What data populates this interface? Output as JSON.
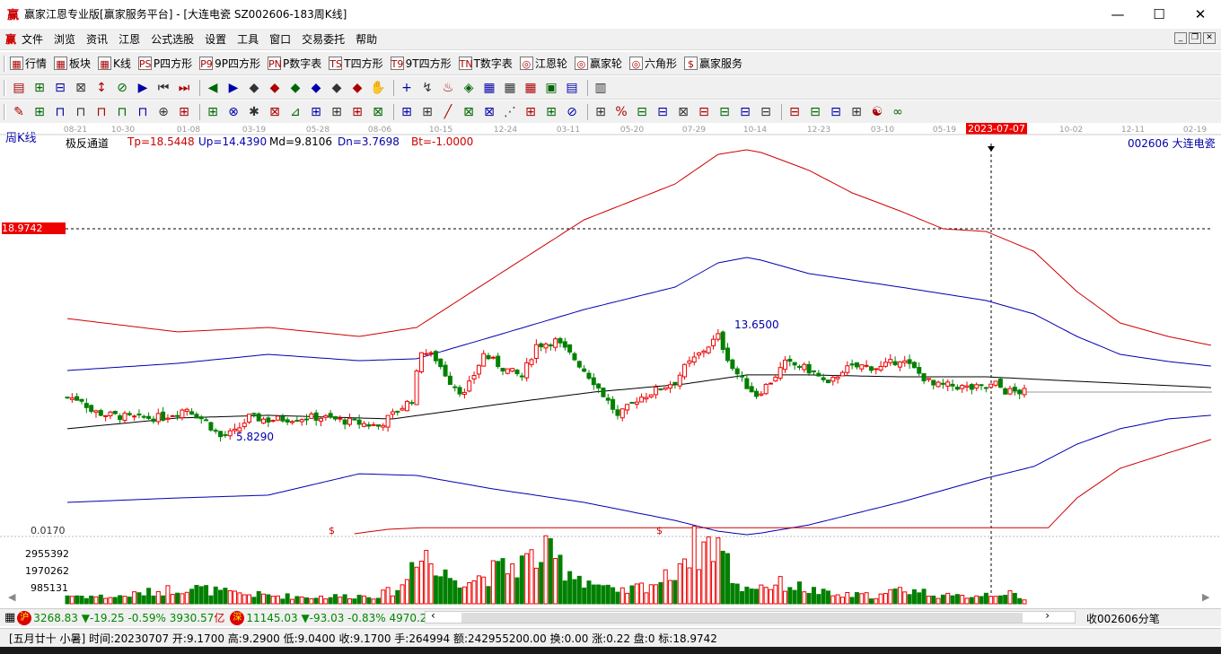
{
  "window": {
    "logo": "赢",
    "title": "赢家江恩专业版[赢家服务平台] - [大连电瓷  SZ002606-183周K线]",
    "min": "—",
    "max": "☐",
    "close": "✕"
  },
  "menu": {
    "logo": "赢",
    "items": [
      "文件",
      "浏览",
      "资讯",
      "江恩",
      "公式选股",
      "设置",
      "工具",
      "窗口",
      "交易委托",
      "帮助"
    ]
  },
  "toolbar1": [
    {
      "icon": "grid-icon",
      "label": "行情"
    },
    {
      "icon": "blocks-icon",
      "label": "板块"
    },
    {
      "icon": "kline-icon",
      "label": "K线"
    },
    {
      "icon": "PS",
      "label": "P四方形"
    },
    {
      "icon": "P9",
      "label": "9P四方形"
    },
    {
      "icon": "PN",
      "label": "P数字表"
    },
    {
      "icon": "TS",
      "label": "T四方形"
    },
    {
      "icon": "T9",
      "label": "9T四方形"
    },
    {
      "icon": "TN",
      "label": "T数字表"
    },
    {
      "icon": "◎",
      "label": "江恩轮"
    },
    {
      "icon": "◎",
      "label": "赢家轮"
    },
    {
      "icon": "◎",
      "label": "六角形"
    },
    {
      "icon": "$",
      "label": "赢家服务"
    }
  ],
  "toolbar2": [
    "▤",
    "⊞",
    "⊟",
    "⊠",
    "↕",
    "⊘",
    "▶",
    "⏮",
    "⏭",
    "◀",
    "▶",
    "◆",
    "◆",
    "◆",
    "◆",
    "◆",
    "◆",
    "✋",
    "+",
    "↯",
    "♨",
    "◈",
    "▦",
    "▦",
    "▦",
    "▣",
    "▤",
    "▥"
  ],
  "toolbar3": [
    "✎",
    "⊞",
    "⊓",
    "⊓",
    "⊓",
    "⊓",
    "⊓",
    "⊕",
    "⊞",
    "⊞",
    "⊗",
    "✱",
    "⊠",
    "⊿",
    "⊞",
    "⊞",
    "⊞",
    "⊠",
    "⊞",
    "⊞",
    "╱",
    "⊠",
    "⊠",
    "⋰",
    "⊞",
    "⊞",
    "⊘",
    "⊞",
    "%",
    "⊟",
    "⊟",
    "⊠",
    "⊟",
    "⊟",
    "⊟",
    "⊟",
    "⊟",
    "⊟",
    "⊟",
    "⊞",
    "☯",
    "∞"
  ],
  "chart": {
    "period_label": "周K线",
    "indicator": {
      "name": "极反通道",
      "tp": "Tp=18.5448",
      "up": "Up=14.4390",
      "md": "Md=9.8106",
      "dn": "Dn=3.7698",
      "bt": "Bt=-1.0000"
    },
    "stock": "002606  大连电瓷",
    "cursor_date": "2023-07-07",
    "cursor_price": "18.9742",
    "high_label": "13.6500",
    "low_label": "5.8290",
    "sub_level": "0.0170",
    "signal_marker": "$",
    "volume_ticks": [
      "2955392",
      "1970262",
      "985131"
    ],
    "x_ticks": [
      "08-21",
      "10-30",
      "01-08",
      "03-19",
      "05-28",
      "08-06",
      "10-15",
      "12-24",
      "03-11",
      "05-20",
      "07-29",
      "10-14",
      "12-23",
      "03-10",
      "05-19",
      "10-02",
      "12-11",
      "02-19"
    ]
  },
  "chart_data": {
    "type": "candlestick",
    "y_scale": {
      "ref_price": 18.9742,
      "low": 5.829,
      "high": 13.65
    },
    "close_keypoints": [
      [
        0,
        8.32
      ],
      [
        3,
        8.21
      ],
      [
        5,
        7.47
      ],
      [
        8,
        7.24
      ],
      [
        14,
        7.02
      ],
      [
        20,
        7.07
      ],
      [
        25,
        7.64
      ],
      [
        29,
        6.79
      ],
      [
        32,
        5.83
      ],
      [
        35,
        6.11
      ],
      [
        38,
        7.07
      ],
      [
        42,
        6.9
      ],
      [
        48,
        7.02
      ],
      [
        53,
        7.07
      ],
      [
        59,
        6.79
      ],
      [
        65,
        6.51
      ],
      [
        68,
        7.24
      ],
      [
        72,
        8.21
      ],
      [
        74,
        11.32
      ],
      [
        77,
        10.76
      ],
      [
        80,
        9.34
      ],
      [
        83,
        8.49
      ],
      [
        87,
        11.04
      ],
      [
        91,
        10.19
      ],
      [
        95,
        9.62
      ],
      [
        98,
        11.61
      ],
      [
        102,
        11.89
      ],
      [
        106,
        10.76
      ],
      [
        110,
        9.34
      ],
      [
        114,
        7.64
      ],
      [
        115,
        7.07
      ],
      [
        119,
        8.21
      ],
      [
        123,
        8.77
      ],
      [
        127,
        9.34
      ],
      [
        129,
        10.19
      ],
      [
        132,
        11.04
      ],
      [
        136,
        12.17
      ],
      [
        139,
        10.19
      ],
      [
        142,
        9.06
      ],
      [
        144,
        8.49
      ],
      [
        147,
        9.34
      ],
      [
        150,
        10.47
      ],
      [
        153,
        10.3
      ],
      [
        156,
        9.91
      ],
      [
        159,
        9.06
      ],
      [
        162,
        10.08
      ],
      [
        166,
        10.3
      ],
      [
        170,
        10.19
      ],
      [
        174,
        10.76
      ],
      [
        177,
        10.08
      ],
      [
        181,
        9.06
      ],
      [
        185,
        9.06
      ],
      [
        189,
        8.89
      ],
      [
        192,
        8.94
      ],
      [
        194,
        9.17
      ],
      [
        196,
        8.72
      ],
      [
        200,
        8.66
      ]
    ],
    "bands": {
      "Tp": {
        "color": "#d00000",
        "points": [
          [
            0,
            13.3
          ],
          [
            23,
            12.46
          ],
          [
            42,
            12.74
          ],
          [
            61,
            12.17
          ],
          [
            73,
            12.74
          ],
          [
            89,
            15.86
          ],
          [
            108,
            19.54
          ],
          [
            127,
            21.8
          ],
          [
            136,
            23.67
          ],
          [
            142,
            23.96
          ],
          [
            145,
            23.79
          ],
          [
            155,
            22.66
          ],
          [
            164,
            21.24
          ],
          [
            174,
            20.1
          ],
          [
            183,
            18.97
          ],
          [
            192,
            18.8
          ],
          [
            202,
            17.55
          ],
          [
            211,
            15.0
          ],
          [
            220,
            13.02
          ],
          [
            230,
            12.17
          ],
          [
            239,
            11.61
          ]
        ]
      },
      "Up": {
        "color": "#0000b0",
        "points": [
          [
            0,
            10.02
          ],
          [
            23,
            10.47
          ],
          [
            42,
            11.04
          ],
          [
            61,
            10.64
          ],
          [
            73,
            10.76
          ],
          [
            89,
            12.17
          ],
          [
            108,
            13.87
          ],
          [
            127,
            15.29
          ],
          [
            136,
            16.82
          ],
          [
            142,
            17.16
          ],
          [
            145,
            16.99
          ],
          [
            155,
            16.14
          ],
          [
            174,
            15.29
          ],
          [
            192,
            14.44
          ],
          [
            202,
            13.59
          ],
          [
            211,
            12.17
          ],
          [
            220,
            11.04
          ],
          [
            230,
            10.59
          ],
          [
            239,
            10.3
          ]
        ]
      },
      "Md": {
        "color": "#000000",
        "points": [
          [
            0,
            6.34
          ],
          [
            23,
            7.02
          ],
          [
            42,
            7.19
          ],
          [
            68,
            6.96
          ],
          [
            91,
            7.92
          ],
          [
            110,
            8.66
          ],
          [
            129,
            9.17
          ],
          [
            142,
            9.74
          ],
          [
            155,
            9.74
          ],
          [
            174,
            9.62
          ],
          [
            192,
            9.62
          ],
          [
            211,
            9.34
          ],
          [
            239,
            8.94
          ]
        ]
      },
      "Dn": {
        "color": "#0000b0",
        "points": [
          [
            0,
            1.69
          ],
          [
            23,
            1.97
          ],
          [
            42,
            2.15
          ],
          [
            61,
            3.5
          ],
          [
            73,
            3.39
          ],
          [
            89,
            2.54
          ],
          [
            108,
            1.69
          ],
          [
            127,
            0.55
          ],
          [
            136,
            -0.13
          ],
          [
            142,
            -0.35
          ],
          [
            145,
            -0.24
          ],
          [
            155,
            0.27
          ],
          [
            174,
            1.69
          ],
          [
            192,
            3.22
          ],
          [
            202,
            3.96
          ],
          [
            211,
            5.37
          ],
          [
            220,
            6.34
          ],
          [
            230,
            6.96
          ],
          [
            239,
            7.19
          ]
        ]
      },
      "Bt": {
        "color": "#d00000",
        "points": [
          [
            60,
            -0.29
          ],
          [
            67,
            -0.01
          ],
          [
            74,
            0.09
          ],
          [
            136,
            0.09
          ],
          [
            205,
            0.09
          ],
          [
            211,
            1.97
          ],
          [
            220,
            3.84
          ],
          [
            230,
            4.81
          ],
          [
            239,
            5.66
          ]
        ]
      }
    },
    "volume_keypoints": [
      [
        0,
        0.5
      ],
      [
        10,
        0.4
      ],
      [
        25,
        1.0
      ],
      [
        35,
        0.6
      ],
      [
        50,
        0.4
      ],
      [
        65,
        0.5
      ],
      [
        70,
        1.0
      ],
      [
        74,
        3.9
      ],
      [
        77,
        1.8
      ],
      [
        85,
        1.5
      ],
      [
        95,
        2.5
      ],
      [
        100,
        3.0
      ],
      [
        108,
        1.5
      ],
      [
        115,
        0.6
      ],
      [
        125,
        1.5
      ],
      [
        130,
        3.3
      ],
      [
        136,
        3.8
      ],
      [
        140,
        1.0
      ],
      [
        150,
        1.2
      ],
      [
        160,
        0.5
      ],
      [
        170,
        0.5
      ],
      [
        175,
        0.9
      ],
      [
        185,
        0.4
      ],
      [
        196,
        0.7
      ],
      [
        200,
        0.2
      ]
    ],
    "volume_unit": "millions"
  },
  "status": {
    "sh_icon": "沪",
    "sh": "3268.83 ▼-19.25 -0.59% 3930.57",
    "sh_unit": "亿",
    "sz_icon": "深",
    "sz": "11145.03 ▼-93.03 -0.83% 4970.20",
    "scroll_left": "‹",
    "scroll_right": "›",
    "recv": "收002606分笔",
    "detail": "[五月廿十 小暑] 时间:20230707 开:9.1700 高:9.2900 低:9.0400 收:9.1700 手:264994 额:242955200.00 换:0.00 涨:0.22 盘:0 标:18.9742"
  }
}
